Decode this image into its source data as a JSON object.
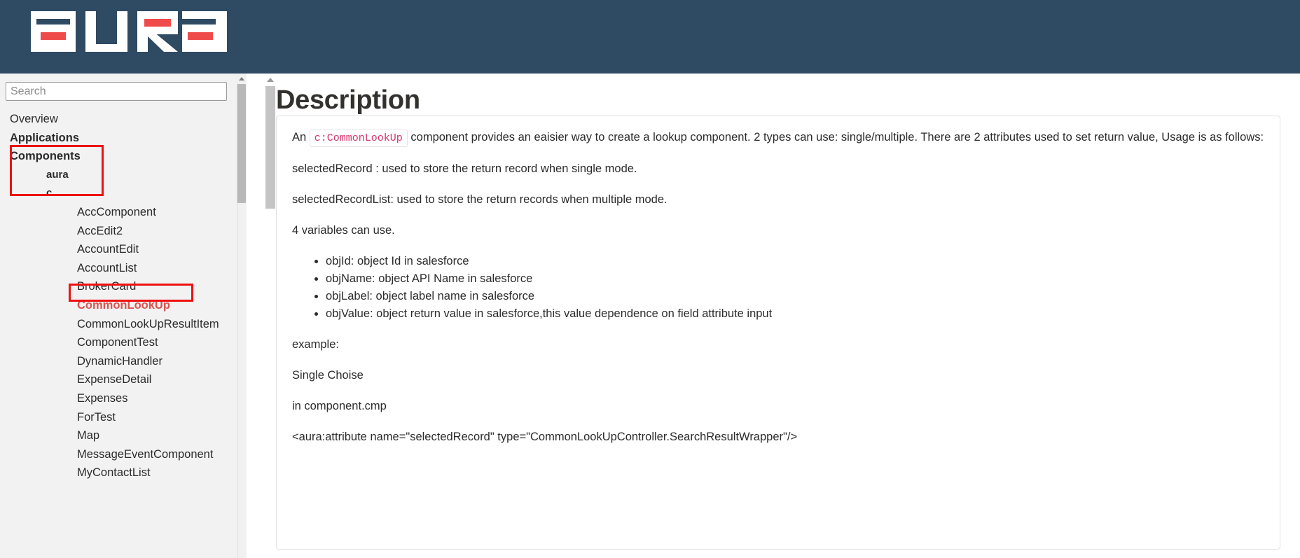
{
  "header": {
    "logo_text": "aura",
    "logo_icon": "aura-logo",
    "bg_color": "#2f4a63",
    "accent_color": "#ef4b4b"
  },
  "sidebar": {
    "search": {
      "placeholder": "Search",
      "value": ""
    },
    "items": [
      {
        "label": "Overview",
        "level": 0,
        "bold": false,
        "active": false
      },
      {
        "label": "Applications",
        "level": 0,
        "bold": true,
        "active": false
      },
      {
        "label": "Components",
        "level": 0,
        "bold": true,
        "active": false
      },
      {
        "label": "aura",
        "level": 1,
        "bold": true,
        "active": false
      },
      {
        "label": "c",
        "level": 1,
        "bold": true,
        "active": false
      },
      {
        "label": "AccComponent",
        "level": 2,
        "bold": false,
        "active": false
      },
      {
        "label": "AccEdit2",
        "level": 2,
        "bold": false,
        "active": false
      },
      {
        "label": "AccountEdit",
        "level": 2,
        "bold": false,
        "active": false
      },
      {
        "label": "AccountList",
        "level": 2,
        "bold": false,
        "active": false
      },
      {
        "label": "BrokerCard",
        "level": 2,
        "bold": false,
        "active": false
      },
      {
        "label": "CommonLookUp",
        "level": 2,
        "bold": true,
        "active": true
      },
      {
        "label": "CommonLookUpResultItem",
        "level": 2,
        "bold": false,
        "active": false
      },
      {
        "label": "ComponentTest",
        "level": 2,
        "bold": false,
        "active": false
      },
      {
        "label": "DynamicHandler",
        "level": 2,
        "bold": false,
        "active": false
      },
      {
        "label": "ExpenseDetail",
        "level": 2,
        "bold": false,
        "active": false
      },
      {
        "label": "Expenses",
        "level": 2,
        "bold": false,
        "active": false
      },
      {
        "label": "ForTest",
        "level": 2,
        "bold": false,
        "active": false
      },
      {
        "label": "Map",
        "level": 2,
        "bold": false,
        "active": false
      },
      {
        "label": "MessageEventComponent",
        "level": 2,
        "bold": false,
        "active": false
      },
      {
        "label": "MyContactList",
        "level": 2,
        "bold": false,
        "active": false
      }
    ],
    "annotation_color": "#ee1111"
  },
  "main": {
    "title": "Description",
    "intro": {
      "before_code": "An",
      "code": "c:CommonLookUp",
      "after_code": "component provides an eaisier way to create a lookup component. 2 types can use: single/multiple. There are 2 attributes used to set return value, Usage is as follows:"
    },
    "paragraphs": {
      "selected_record": "selectedRecord : used to store the return record when single mode.",
      "selected_record_list": "selectedRecordList: used to store the return records when multiple mode.",
      "variables_intro": "4 variables can use.",
      "example": "example:",
      "single_choise": "Single Choise",
      "in_component": "in component.cmp",
      "aura_attribute": "<aura:attribute name=\"selectedRecord\" type=\"CommonLookUpController.SearchResultWrapper\"/>"
    },
    "variables": [
      "objId: object Id in salesforce",
      "objName: object API Name in salesforce",
      "objLabel: object label name in salesforce",
      "objValue: object return value in salesforce,this value dependence on field attribute input"
    ]
  }
}
